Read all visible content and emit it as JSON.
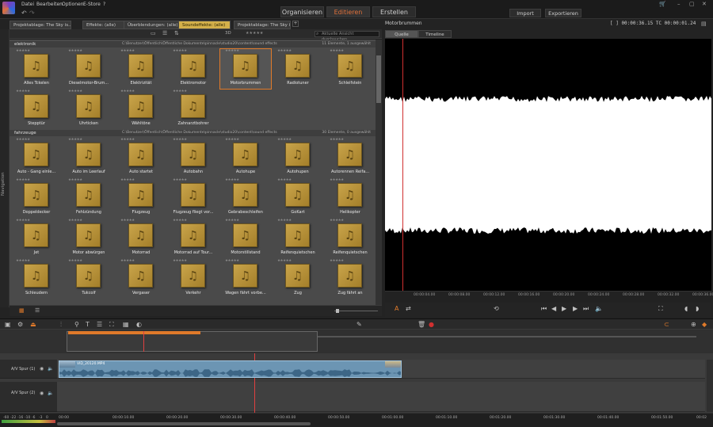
{
  "menu": {
    "items": [
      "Datei",
      "Bearbeiten",
      "Optionen",
      "E-Store",
      "?"
    ]
  },
  "modes": {
    "organize": "Organisieren",
    "edit": "Editieren",
    "create": "Erstellen"
  },
  "actions": {
    "import": "Import",
    "export": "Exportieren"
  },
  "library": {
    "tabs": [
      "Projektablage: The Sky is...",
      "Effekte: (alle)",
      "Überblendungen: (alle)",
      "Soundeffekte: (alle)",
      "Projektablage: The Sky is..."
    ],
    "active_tab": 3,
    "search_placeholder": "Aktuelle Ansicht durchsuchen",
    "nav_label": "Navigation",
    "groups": [
      {
        "name": "elektronik",
        "path": "C:\\Benutzer\\Öffentlich\\Öffentliche Dokumente\\pinnacle\\studio20\\content\\sound effects",
        "count": "11 Elemente, 1 ausgewählt",
        "items": [
          "Alles Tckelen",
          "Dieselmotor-Brum...",
          "Elektrizität",
          "Elektromotor",
          "Motorbrummen",
          "Radiotuner",
          "Schleifstein",
          "Stepptür",
          "Uhrticken",
          "Wähltöne",
          "Zahnarztbohrer"
        ],
        "selected": 4
      },
      {
        "name": "fahrzeuge",
        "path": "C:\\Benutzer\\Öffentlich\\Öffentliche Dokumente\\pinnacle\\studio20\\content\\sound effects",
        "count": "30 Elemente, 0 ausgewählt",
        "items": [
          "Auto - Gang einle...",
          "Auto im Leerlauf",
          "Auto startet",
          "Autobahn",
          "Autohupe",
          "Autohupen",
          "Autorennen Reifa...",
          "Doppeldecker",
          "Fehlzündung",
          "Flugzeug",
          "Flugzeug fliegt vor...",
          "Gebrabeschleifen",
          "GoKart",
          "Helikopter",
          "Jet",
          "Motor abwürgen",
          "Motorrad",
          "Motorrad auf Tour...",
          "Motorstillstand",
          "Reifenquietschen",
          "Reifenquietschen",
          "Schleudern",
          "Tukcolf",
          "Vergaser",
          "Verkehr",
          "Wagen fährt vorbe...",
          "Zug",
          "Zug fährt an"
        ]
      }
    ]
  },
  "player": {
    "title": "Motorbrummen",
    "time": "[ ] 00:00:36.15  TC  00:00:01.24",
    "tabs": [
      "Quelle",
      "Timeline"
    ],
    "ruler": [
      "00:00:04.00",
      "00:00:08.00",
      "00:00:12.00",
      "00:00:16.00",
      "00:00:20.00",
      "00:00:24.00",
      "00:00:28.00",
      "00:00:32.00",
      "00:00:36.00"
    ]
  },
  "timeline": {
    "tracks": [
      "A/V Spur (1)",
      "A/V Spur (2)"
    ],
    "clip_name": "VID_20120.MP4",
    "ruler": [
      "00:00",
      "00:00:10.00",
      "00:00:20.00",
      "00:00:30.00",
      "00:00:40.00",
      "00:00:50.00",
      "00:01:00.00",
      "00:01:10.00",
      "00:01:20.00",
      "00:01:30.00",
      "00:01:40.00",
      "00:01:50.00",
      "00:02"
    ],
    "meter_labels": [
      "-60",
      "-22",
      "-16",
      "-10",
      "-6",
      "-3",
      "0"
    ]
  },
  "colors": {
    "accent": "#e07a2a",
    "tile": "#c9a44a",
    "clip": "#6c95b3"
  }
}
